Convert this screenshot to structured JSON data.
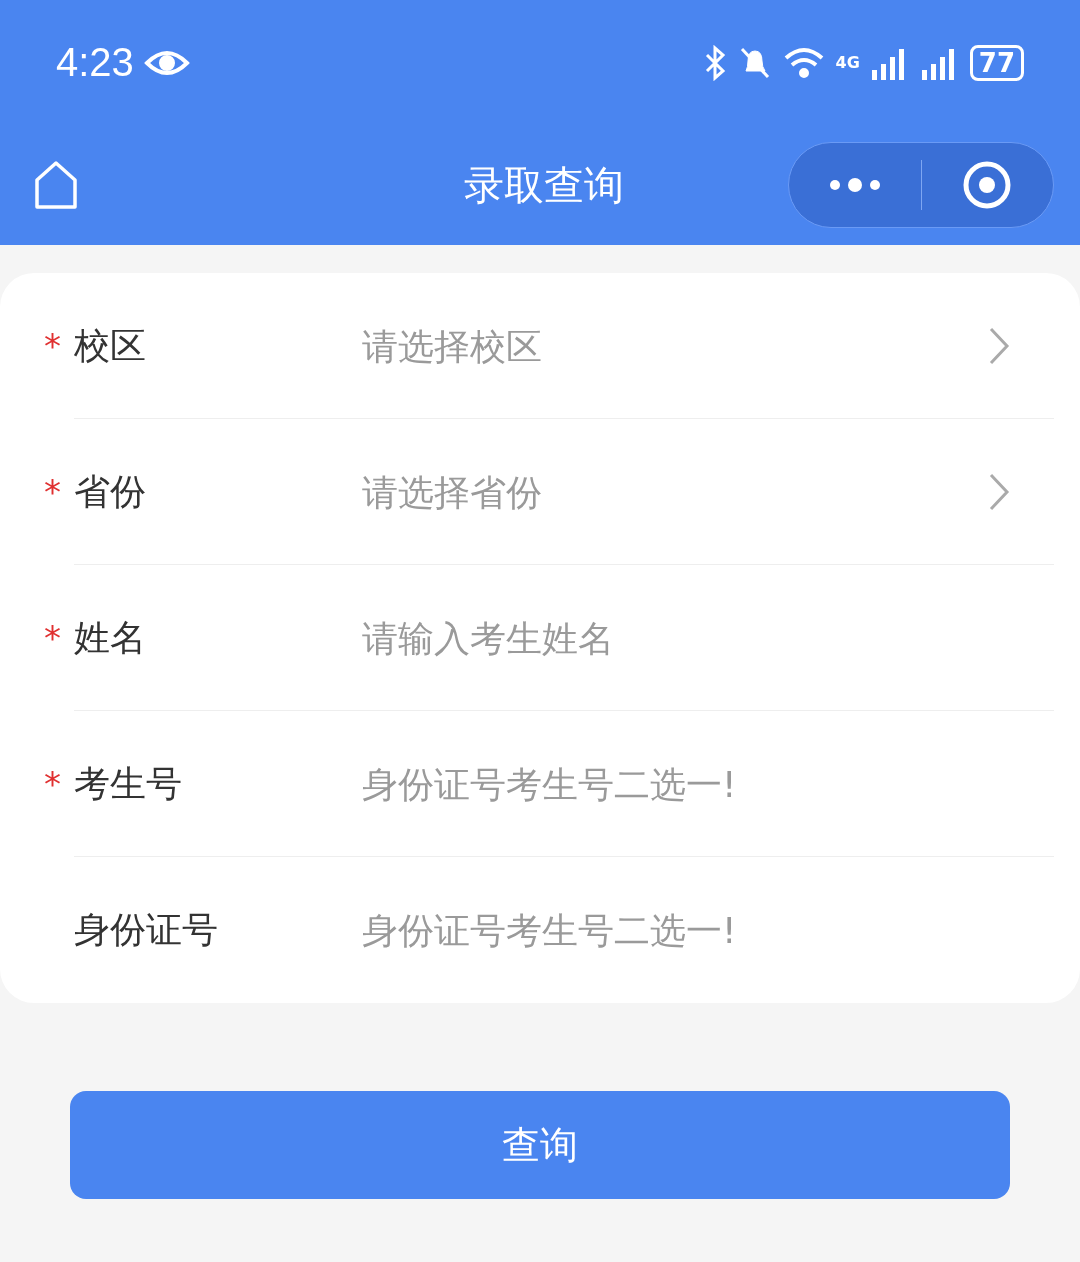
{
  "status_bar": {
    "time": "4:23",
    "network": "4G",
    "battery": "77"
  },
  "nav_bar": {
    "title": "录取查询"
  },
  "form": {
    "fields": [
      {
        "mark": "*",
        "label": "校区",
        "kind": "select",
        "placeholder": "请选择校区"
      },
      {
        "mark": "*",
        "label": "省份",
        "kind": "select",
        "placeholder": "请选择省份"
      },
      {
        "mark": "*",
        "label": "姓名",
        "kind": "input",
        "placeholder": "请输入考生姓名"
      },
      {
        "mark": "*",
        "label": "考生号",
        "kind": "input",
        "placeholder": "身份证号考生号二选一!"
      },
      {
        "label": "身份证号",
        "kind": "input",
        "placeholder": "身份证号考生号二选一!"
      }
    ]
  },
  "submit_button": {
    "label": "查询"
  }
}
